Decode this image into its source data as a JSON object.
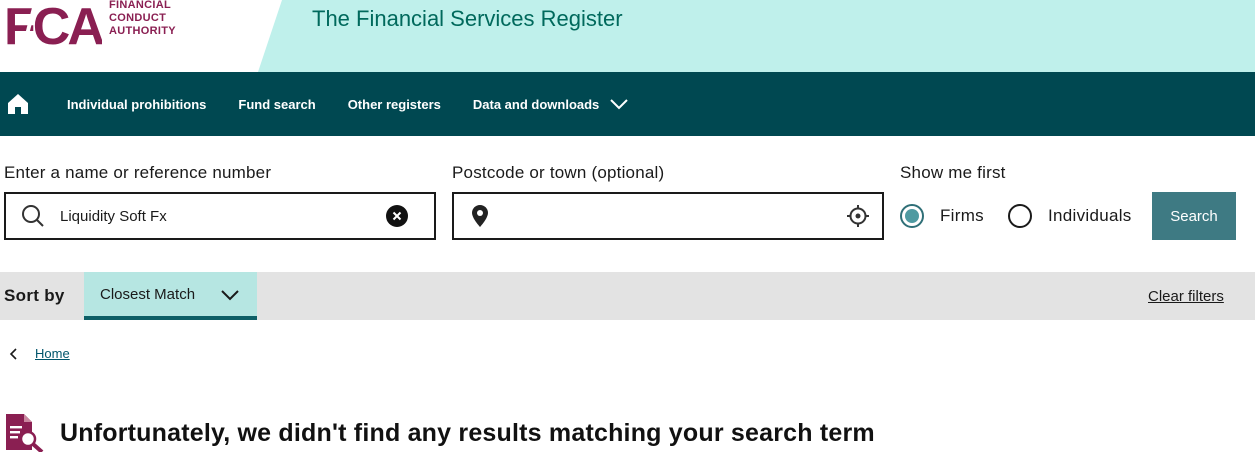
{
  "header": {
    "logo_mark": "FCA",
    "logo_lines": [
      "FINANCIAL",
      "CONDUCT",
      "AUTHORITY"
    ],
    "site_title": "The Financial Services Register",
    "colors": {
      "brand": "#8a1f52",
      "band": "#bff0eb",
      "title": "#00695c"
    }
  },
  "nav": {
    "home_icon": "home-icon",
    "items": [
      {
        "label": "Individual prohibitions"
      },
      {
        "label": "Fund search"
      },
      {
        "label": "Other registers"
      },
      {
        "label": "Data and downloads",
        "icon": "chevron-down-icon"
      }
    ],
    "colors": {
      "background": "#004851",
      "text": "#ffffff"
    }
  },
  "search": {
    "name_label": "Enter a name or reference number",
    "name_value": "Liquidity Soft Fx",
    "location_label": "Postcode or town (optional)",
    "location_value": "",
    "show_me_first_label": "Show me first",
    "options": [
      {
        "label": "Firms",
        "selected": true
      },
      {
        "label": "Individuals",
        "selected": false
      }
    ],
    "search_button": "Search",
    "colors": {
      "button": "#3e7a83"
    }
  },
  "sort": {
    "label": "Sort by",
    "selected": "Closest Match",
    "clear_filters": "Clear filters"
  },
  "breadcrumb": {
    "home": "Home"
  },
  "results": {
    "message": "Unfortunately, we didn't find any results matching your search term",
    "icon": "document-search-icon"
  }
}
